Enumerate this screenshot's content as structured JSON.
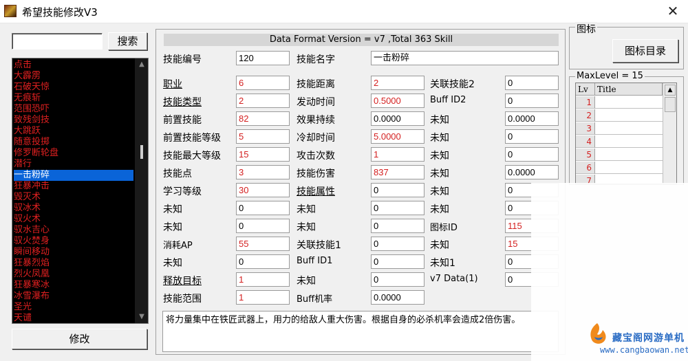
{
  "window": {
    "title": "希望技能修改V3",
    "close_glyph": "✕"
  },
  "left": {
    "search_value": "",
    "search_button": "搜索",
    "modify_button": "修改",
    "skills": [
      {
        "name": "点击",
        "selected": false
      },
      {
        "name": "大霹雳",
        "selected": false
      },
      {
        "name": "石破天惊",
        "selected": false
      },
      {
        "name": "无痕斩",
        "selected": false
      },
      {
        "name": "范围恐吓",
        "selected": false
      },
      {
        "name": "致残剑技",
        "selected": false
      },
      {
        "name": "大跳跃",
        "selected": false
      },
      {
        "name": "随意投掷",
        "selected": false
      },
      {
        "name": "修罗断轮盘",
        "selected": false
      },
      {
        "name": "潜行",
        "selected": false
      },
      {
        "name": "一击粉碎",
        "selected": true
      },
      {
        "name": "狂暴冲击",
        "selected": false
      },
      {
        "name": "毁灭术",
        "selected": false
      },
      {
        "name": "驭冰术",
        "selected": false
      },
      {
        "name": "驭火术",
        "selected": false
      },
      {
        "name": "驭水吉心",
        "selected": false
      },
      {
        "name": "驭火焚身",
        "selected": false
      },
      {
        "name": "瞬间移动",
        "selected": false
      },
      {
        "name": "狂暴烈焰",
        "selected": false
      },
      {
        "name": "烈火凤凰",
        "selected": false
      },
      {
        "name": "狂暴寒冰",
        "selected": false
      },
      {
        "name": "冰雪瀑布",
        "selected": false
      },
      {
        "name": "圣光",
        "selected": false
      },
      {
        "name": "天谴",
        "selected": false
      }
    ]
  },
  "main": {
    "format_line": "Data Format Version = v7 ,Total 363 Skill",
    "col1": [
      {
        "label": "技能编号",
        "value": "120",
        "red": false,
        "underline": false
      },
      {
        "label": "职业",
        "value": "6",
        "red": true,
        "underline": true
      },
      {
        "label": "技能类型",
        "value": "2",
        "red": true,
        "underline": true
      },
      {
        "label": "前置技能",
        "value": "82",
        "red": true,
        "underline": false
      },
      {
        "label": "前置技能等级",
        "value": "5",
        "red": true,
        "underline": false
      },
      {
        "label": "技能最大等级",
        "value": "15",
        "red": true,
        "underline": false
      },
      {
        "label": "技能点",
        "value": "3",
        "red": true,
        "underline": false
      },
      {
        "label": "学习等级",
        "value": "30",
        "red": true,
        "underline": false
      },
      {
        "label": "未知",
        "value": "0",
        "red": false,
        "underline": false
      },
      {
        "label": "未知",
        "value": "0",
        "red": false,
        "underline": false
      },
      {
        "label": "消耗AP",
        "value": "55",
        "red": true,
        "underline": false
      },
      {
        "label": "未知",
        "value": "0",
        "red": false,
        "underline": false
      },
      {
        "label": "释放目标",
        "value": "1",
        "red": true,
        "underline": true
      },
      {
        "label": "技能范围",
        "value": "1",
        "red": true,
        "underline": false
      }
    ],
    "col2": [
      {
        "label": "技能名字",
        "value": "一击粉碎",
        "red": false,
        "underline": false
      },
      {
        "label": "技能距离",
        "value": "2",
        "red": true,
        "underline": false
      },
      {
        "label": "发动时间",
        "value": "0.5000",
        "red": true,
        "underline": false
      },
      {
        "label": "效果持续",
        "value": "0.0000",
        "red": false,
        "underline": false
      },
      {
        "label": "冷却时间",
        "value": "5.0000",
        "red": true,
        "underline": false
      },
      {
        "label": "攻击次数",
        "value": "1",
        "red": true,
        "underline": false
      },
      {
        "label": "技能伤害",
        "value": "837",
        "red": true,
        "underline": false
      },
      {
        "label": "技能属性",
        "value": "0",
        "red": false,
        "underline": true
      },
      {
        "label": "未知",
        "value": "0",
        "red": false,
        "underline": false
      },
      {
        "label": "未知",
        "value": "0",
        "red": false,
        "underline": false
      },
      {
        "label": "关联技能1",
        "value": "0",
        "red": false,
        "underline": false
      },
      {
        "label": "Buff ID1",
        "value": "0",
        "red": false,
        "underline": false
      },
      {
        "label": "未知",
        "value": "0",
        "red": false,
        "underline": false
      },
      {
        "label": "Buff机率",
        "value": "0.0000",
        "red": false,
        "underline": false
      }
    ],
    "col3": [
      {
        "label": "关联技能2",
        "value": "0",
        "red": false,
        "underline": false
      },
      {
        "label": "Buff ID2",
        "value": "0",
        "red": false,
        "underline": false
      },
      {
        "label": "未知",
        "value": "0.0000",
        "red": false,
        "underline": false
      },
      {
        "label": "未知",
        "value": "0",
        "red": false,
        "underline": false
      },
      {
        "label": "未知",
        "value": "0",
        "red": false,
        "underline": false
      },
      {
        "label": "未知",
        "value": "0.0000",
        "red": false,
        "underline": false
      },
      {
        "label": "未知",
        "value": "0",
        "red": false,
        "underline": false
      },
      {
        "label": "未知",
        "value": "0",
        "red": false,
        "underline": false
      },
      {
        "label": "图标ID",
        "value": "115",
        "red": true,
        "underline": false
      },
      {
        "label": "未知",
        "value": "15",
        "red": true,
        "underline": false
      },
      {
        "label": "未知1",
        "value": "0",
        "red": false,
        "underline": false
      },
      {
        "label": "v7 Data(1)",
        "value": "0",
        "red": false,
        "underline": false
      }
    ],
    "description": "将力量集中在铁匠武器上，用力的给敌人重大伤害。根据自身的必杀机率会造成2倍伤害。"
  },
  "right": {
    "icon_group_title": "图标",
    "icon_dir_button": "图标目录",
    "level_group_title": "MaxLevel = 15",
    "grid_headers": [
      "Lv",
      "Title"
    ],
    "levels": [
      "1",
      "2",
      "3",
      "4",
      "5",
      "6",
      "7"
    ]
  },
  "watermark": {
    "name": "藏宝阁网游单机",
    "url": "www.cangbaowan.net"
  },
  "colors": {
    "list_bg": "#000000",
    "list_text": "#e02020",
    "selection": "#0a64d8",
    "accent_red": "#d42020",
    "watermark_blue": "#2a6cc4"
  }
}
